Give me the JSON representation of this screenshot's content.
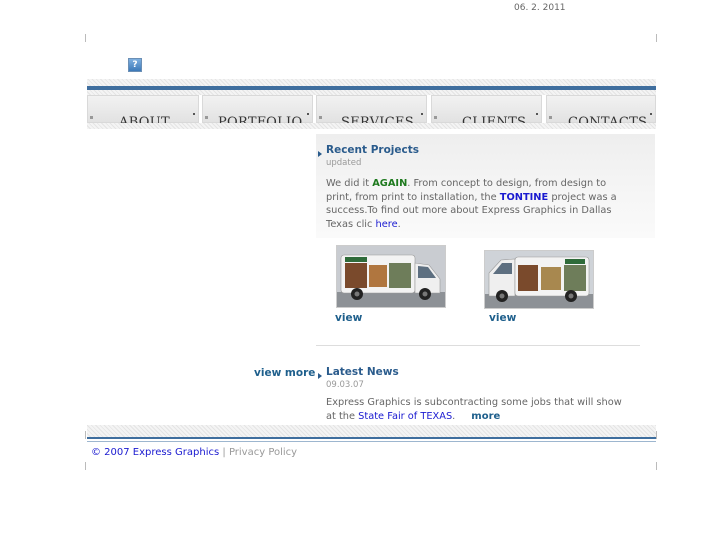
{
  "header": {
    "date": "06. 2. 2011",
    "help_glyph": "?"
  },
  "nav": {
    "items": [
      {
        "label": "ABOUT"
      },
      {
        "label": "PORTFOLIO"
      },
      {
        "label": "SERVICES"
      },
      {
        "label": "CLIENTS"
      },
      {
        "label": "CONTACTS"
      }
    ]
  },
  "recent": {
    "title": "Recent Projects",
    "subtitle": "updated",
    "text_1": "We did it ",
    "again": "AGAIN",
    "text_2": ". From concept to design, from design to print, from print to installation, the ",
    "tontine": "TONTINE",
    "text_3": " project was a success.To find out more about Express Graphics in Dallas Texas clic ",
    "here": "here",
    "text_4": ".",
    "view_1": "view",
    "view_2": "view"
  },
  "news": {
    "view_more": "view more",
    "title": "Latest News",
    "date": "09.03.07",
    "text_1": "Express Graphics is subcontracting some jobs that will show at the ",
    "fair": "State Fair of TEXAS",
    "text_2": ".",
    "more": "more"
  },
  "footer": {
    "copyright": "© 2007 Express Graphics",
    "separator": " | ",
    "privacy": "Privacy Policy"
  },
  "colors": {
    "accent": "#3f6e9e",
    "link": "#1e5f8c",
    "highlight_green": "#1e7a1e",
    "highlight_blue": "#1a1ad0"
  },
  "icons": [
    "help-icon",
    "arrow-bullet-icon"
  ]
}
